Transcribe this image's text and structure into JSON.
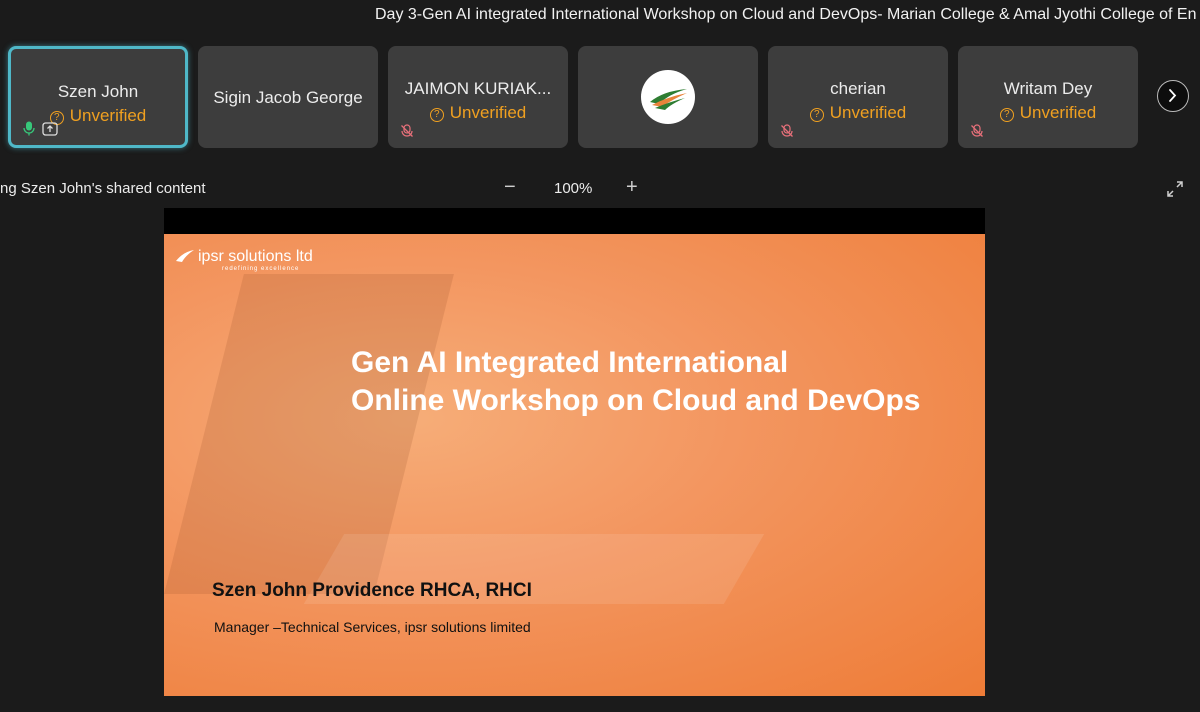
{
  "meeting": {
    "title": "Day 3-Gen AI integrated International Workshop on Cloud and DevOps- Marian College & Amal Jyothi College of En"
  },
  "participants": [
    {
      "name": "Szen John",
      "status": "Unverified",
      "active": true
    },
    {
      "name": "Sigin Jacob George",
      "status": ""
    },
    {
      "name": "JAIMON KURIAK...",
      "status": "Unverified"
    },
    {
      "name": "",
      "status": ""
    },
    {
      "name": "cherian",
      "status": "Unverified"
    },
    {
      "name": "Writam Dey",
      "status": "Unverified"
    }
  ],
  "share": {
    "label": "ng Szen John's shared content",
    "zoom_minus": "−",
    "zoom": "100%",
    "zoom_plus": "+"
  },
  "slide": {
    "brand": "ipsr solutions ltd",
    "brand_tagline": "redefining excellence",
    "title_line1": "Gen AI Integrated International",
    "title_line2": "Online Workshop on Cloud and DevOps",
    "presenter": "Szen John Providence RHCA, RHCI",
    "role": "Manager –Technical Services, ipsr solutions limited"
  },
  "colors": {
    "accent": "#4fb8c8",
    "unverified": "#f0a020",
    "muted_mic": "#e8707a"
  }
}
